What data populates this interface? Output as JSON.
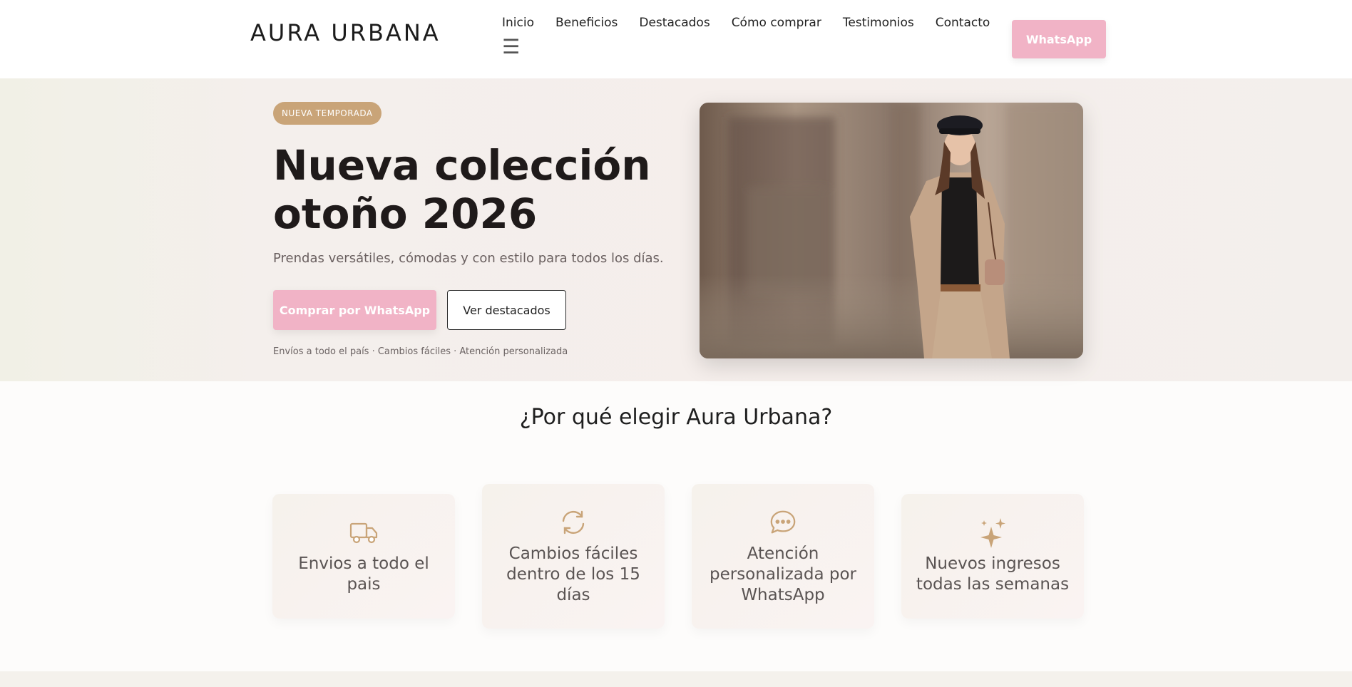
{
  "header": {
    "logo": "AURA URBANA",
    "nav": [
      "Inicio",
      "Beneficios",
      "Destacados",
      "Cómo comprar",
      "Testimonios",
      "Contacto"
    ],
    "hamburger": "☰",
    "whatsapp_label": "WhatsApp"
  },
  "hero": {
    "badge": "NUEVA TEMPORADA",
    "title": "Nueva colección otoño 2026",
    "subtitle": "Prendas versátiles, cómodas y con estilo para todos los días.",
    "primary_cta": "Comprar por WhatsApp",
    "secondary_cta": "Ver destacados",
    "meta": "Envíos a todo el país · Cambios fáciles · Atención personalizada"
  },
  "benefits": {
    "title": "¿Por qué elegir Aura Urbana?",
    "items": [
      {
        "label": "Envios a todo el pais",
        "icon": "truck-icon"
      },
      {
        "label": "Cambios fáciles dentro de los 15 días",
        "icon": "refresh-icon"
      },
      {
        "label": "Atención personalizada por WhatsApp",
        "icon": "chat-icon"
      },
      {
        "label": "Nuevos ingresos todas las semanas",
        "icon": "sparkle-icon"
      }
    ]
  },
  "colors": {
    "accent_pink": "#f1b3c6",
    "accent_gold": "#c9a478",
    "text_dark": "#1f1a1a"
  }
}
